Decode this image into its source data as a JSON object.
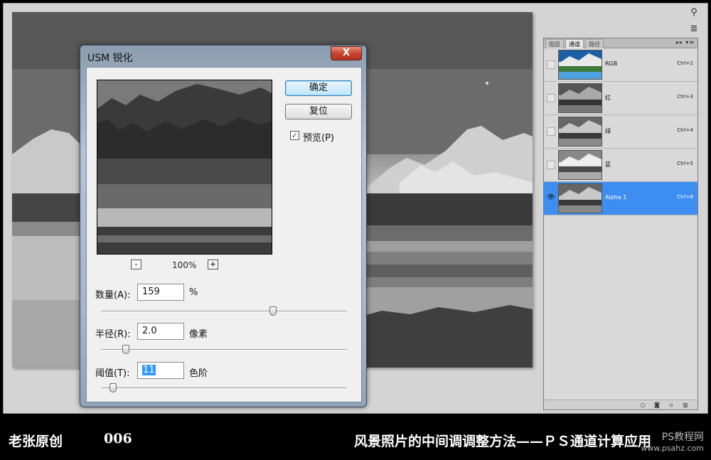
{
  "dialog": {
    "title": "USM 锐化",
    "close_glyph": "X",
    "ok_label": "确定",
    "reset_label": "复位",
    "preview_checked": true,
    "preview_label": "预览(P)",
    "zoom_out": "-",
    "zoom_in": "+",
    "zoom_level": "100%",
    "amount": {
      "label": "数量(A):",
      "value": "159",
      "unit": "%",
      "slider_fraction": 0.7
    },
    "radius": {
      "label": "半径(R):",
      "value": "2.0",
      "unit": "像素",
      "slider_fraction": 0.1
    },
    "threshold": {
      "label": "阈值(T):",
      "value": "11",
      "unit": "色阶",
      "slider_fraction": 0.05
    }
  },
  "panel": {
    "tabs": [
      "图层",
      "通道",
      "路径"
    ],
    "active_tab": "通道",
    "menu_glyph": "▸▸ ▾≡",
    "channels": [
      {
        "name": "RGB",
        "shortcut": "Ctrl+2",
        "visible": false,
        "selected": false,
        "thumb": "color"
      },
      {
        "name": "红",
        "shortcut": "Ctrl+3",
        "visible": false,
        "selected": false,
        "thumb": "gray-dark"
      },
      {
        "name": "绿",
        "shortcut": "Ctrl+4",
        "visible": false,
        "selected": false,
        "thumb": "gray"
      },
      {
        "name": "蓝",
        "shortcut": "Ctrl+5",
        "visible": false,
        "selected": false,
        "thumb": "gray-light"
      },
      {
        "name": "Alpha 1",
        "shortcut": "Ctrl+6",
        "visible": true,
        "selected": true,
        "thumb": "gray"
      }
    ]
  },
  "caption": {
    "author": "老张原创",
    "number": "006",
    "title": "风景照片的中间调调整方法——ＰＳ通道计算应用"
  },
  "watermark": {
    "line1": "PS教程网",
    "line2": "www.psahz.com"
  },
  "icons": {
    "eye": "eye-icon",
    "check": "checkmark-icon"
  },
  "colors": {
    "selected_row": "#3d8ef0",
    "close_button": "#c64530",
    "ok_highlight": "#bee6fd"
  }
}
